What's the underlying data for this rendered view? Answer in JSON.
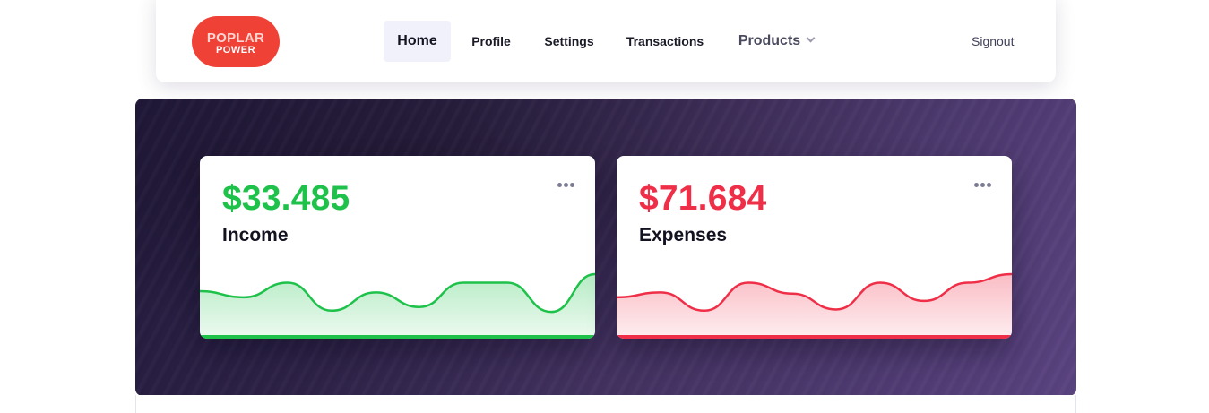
{
  "logo": {
    "line1": "POPLAR",
    "line2": "POWER",
    "color": "#ef4136"
  },
  "nav": {
    "items": [
      {
        "label": "Home",
        "active": true
      },
      {
        "label": "Profile"
      },
      {
        "label": "Settings"
      },
      {
        "label": "Transactions"
      },
      {
        "label": "Products",
        "has_dropdown": true,
        "icon": "chevron-down-icon"
      }
    ],
    "signout": "Signout"
  },
  "cards": [
    {
      "amount": "$33.485",
      "label": "Income",
      "color": "#1ec24a",
      "menu_icon": "more-horizontal-icon",
      "sparkline": [
        0.72,
        0.62,
        0.86,
        0.4,
        0.7,
        0.46,
        0.86,
        0.86,
        0.38,
        1.0
      ]
    },
    {
      "amount": "$71.684",
      "label": "Expenses",
      "color": "#ef2f48",
      "menu_icon": "more-horizontal-icon",
      "sparkline": [
        0.62,
        0.7,
        0.4,
        0.86,
        0.68,
        0.42,
        0.86,
        0.56,
        0.86,
        1.0
      ]
    }
  ]
}
